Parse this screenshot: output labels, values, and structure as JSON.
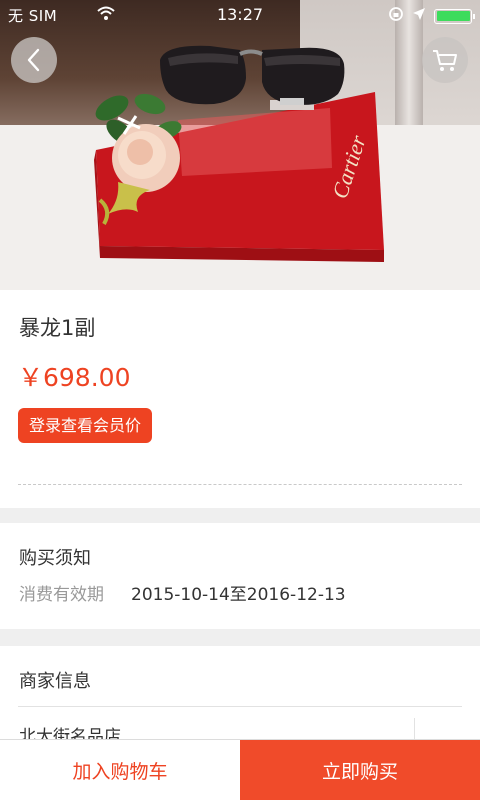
{
  "status_bar": {
    "carrier": "无 SIM",
    "time": "13:27"
  },
  "hero": {
    "back_icon": "chevron-left-icon",
    "cart_icon": "shopping-cart-icon",
    "brand_on_box": "Cartier"
  },
  "product": {
    "title": "暴龙1副",
    "price": "￥698.00",
    "member_price_label": "登录查看会员价"
  },
  "notice": {
    "title": "购买须知",
    "validity_label": "消费有效期",
    "validity_value": "2015-10-14至2016-12-13"
  },
  "merchant": {
    "title": "商家信息",
    "store_name": "北大街名品店"
  },
  "actions": {
    "add_to_cart": "加入购物车",
    "buy_now": "立即购买"
  },
  "colors": {
    "accent": "#ee4322",
    "background": "#efefef"
  }
}
